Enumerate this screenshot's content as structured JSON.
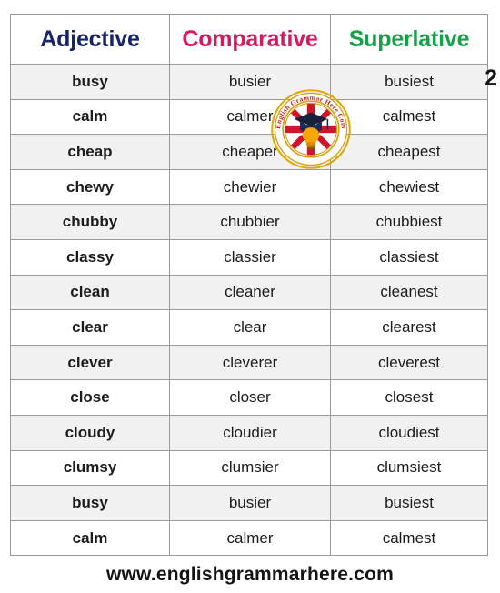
{
  "page": {
    "number_label": "2",
    "footer_url": "www.englishgrammarhere.com",
    "background_color": "#ffffff"
  },
  "table": {
    "headers": [
      {
        "label": "Adjective",
        "color": "#16246b"
      },
      {
        "label": "Comparative",
        "color": "#d6195f"
      },
      {
        "label": "Superlative",
        "color": "#17a04a"
      }
    ],
    "rows": [
      {
        "adjective": "busy",
        "comparative": "busier",
        "superlative": "busiest"
      },
      {
        "adjective": "calm",
        "comparative": "calmer",
        "superlative": "calmest"
      },
      {
        "adjective": "cheap",
        "comparative": "cheaper",
        "superlative": "cheapest"
      },
      {
        "adjective": "chewy",
        "comparative": "chewier",
        "superlative": "chewiest"
      },
      {
        "adjective": "chubby",
        "comparative": "chubbier",
        "superlative": "chubbiest"
      },
      {
        "adjective": "classy",
        "comparative": "classier",
        "superlative": "classiest"
      },
      {
        "adjective": "clean",
        "comparative": "cleaner",
        "superlative": "cleanest"
      },
      {
        "adjective": "clear",
        "comparative": "clear",
        "superlative": "clearest"
      },
      {
        "adjective": "clever",
        "comparative": "cleverer",
        "superlative": "cleverest"
      },
      {
        "adjective": "close",
        "comparative": "closer",
        "superlative": "closest"
      },
      {
        "adjective": "cloudy",
        "comparative": "cloudier",
        "superlative": "cloudiest"
      },
      {
        "adjective": "clumsy",
        "comparative": "clumsier",
        "superlative": "clumsiest"
      },
      {
        "adjective": "busy",
        "comparative": "busier",
        "superlative": "busiest"
      },
      {
        "adjective": "calm",
        "comparative": "calmer",
        "superlative": "calmest"
      }
    ],
    "row_stripe_color": "#f1f1f1",
    "border_color": "#9a9a9a"
  },
  "logo": {
    "name": "english-grammar-here-logo",
    "arc_text": "English Grammar Here Com",
    "ring_color": "#e0a800",
    "arc_text_color": "#c0271f",
    "flag": "union-jack",
    "symbols": [
      "graduation-cap",
      "lightbulb"
    ]
  }
}
